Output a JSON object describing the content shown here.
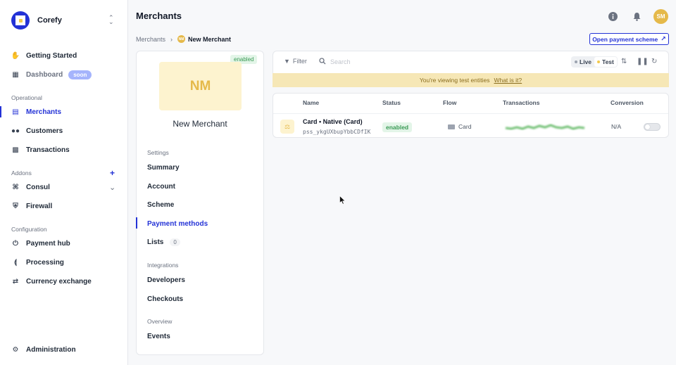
{
  "app": {
    "name": "Corefy"
  },
  "sidebar": {
    "items": [
      {
        "label": "Getting Started",
        "icon": "waving-hand-icon"
      },
      {
        "label": "Dashboard",
        "icon": "dashboard-icon",
        "badge": "soon"
      }
    ],
    "sections": [
      {
        "label": "Operational",
        "items": [
          {
            "label": "Merchants",
            "icon": "merchants-icon",
            "active": true
          },
          {
            "label": "Customers",
            "icon": "customers-icon"
          },
          {
            "label": "Transactions",
            "icon": "transactions-icon"
          }
        ]
      },
      {
        "label": "Addons",
        "items": [
          {
            "label": "Consul",
            "icon": "consul-icon"
          },
          {
            "label": "Firewall",
            "icon": "shield-icon"
          }
        ]
      },
      {
        "label": "Configuration",
        "items": [
          {
            "label": "Payment hub",
            "icon": "plug-icon"
          },
          {
            "label": "Processing",
            "icon": "share-icon"
          },
          {
            "label": "Currency exchange",
            "icon": "exchange-icon"
          }
        ]
      }
    ],
    "footer": {
      "label": "Administration",
      "icon": "gear-icon"
    }
  },
  "header": {
    "title": "Merchants",
    "avatar_initials": "SM"
  },
  "breadcrumb": {
    "parent": "Merchants",
    "current_avatar": "NM",
    "current": "New Merchant"
  },
  "actions": {
    "open_scheme": "Open payment scheme"
  },
  "merchant": {
    "status": "enabled",
    "initials": "NM",
    "name": "New Merchant",
    "menu": {
      "settings_label": "Settings",
      "summary": "Summary",
      "account": "Account",
      "scheme": "Scheme",
      "payment_methods": "Payment methods",
      "lists": "Lists",
      "lists_count": "0",
      "integrations_label": "Integrations",
      "developers": "Developers",
      "checkouts": "Checkouts",
      "overview_label": "Overview",
      "events": "Events"
    }
  },
  "toolbar": {
    "filter": "Filter",
    "search_placeholder": "Search",
    "live": "Live",
    "test": "Test",
    "live_color": "#9ca3af",
    "test_color": "#f2c94c"
  },
  "banner": {
    "text": "You're viewing test entities",
    "link": "What is it?"
  },
  "table": {
    "columns": [
      "Name",
      "Status",
      "Flow",
      "Transactions",
      "Conversion"
    ],
    "rows": [
      {
        "name": "Card • Native (Card)",
        "id": "pss_ykgUXbupYbbCDfIK",
        "status": "enabled",
        "flow": "Card",
        "conversion": "N/A",
        "enabled": false
      }
    ]
  },
  "colors": {
    "accent": "#2332d6",
    "enabled_bg": "#e3f5e8",
    "enabled_text": "#3a9a55",
    "banner_bg": "#f6e7b6",
    "merchant_tile": "#fdf3cf"
  }
}
